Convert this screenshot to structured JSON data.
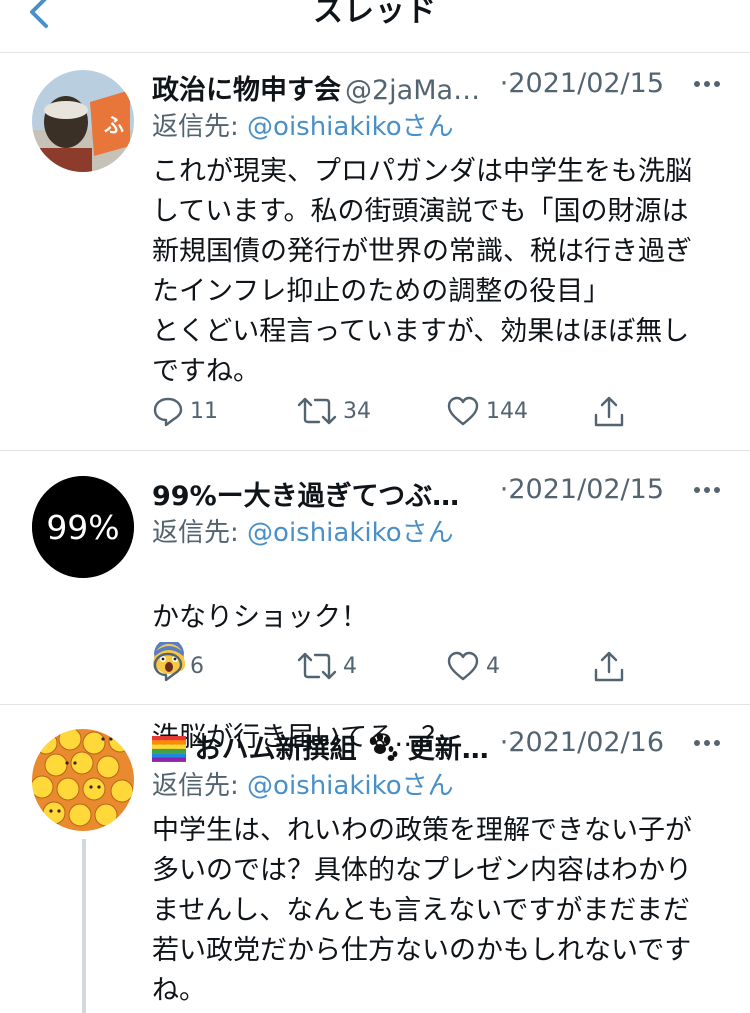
{
  "header": {
    "title": "スレッド"
  },
  "tweets": [
    {
      "name": "政治に物申す会",
      "handle": "@2jaMa…",
      "date": "·2021/02/15",
      "reply_prefix": "返信先: ",
      "reply_mention": "@oishiakiko",
      "reply_suffix": "さん",
      "body": "これが現実、プロパガンダは中学生をも洗脳\nしています。私の街頭演説でも「国の財源は\n新規国債の発行が世界の常識、税は行き過ぎ\nたインフレ抑止のための調整の役目」\nとくどい程言っていますが、効果はほぼ無し\nですね。",
      "replies": "11",
      "retweets": "34",
      "likes": "144"
    },
    {
      "name": "99%ー大き過ぎてつぶ…",
      "avatar_text": "99%",
      "date": "·2021/02/15",
      "reply_prefix": "返信先: ",
      "reply_mention": "@oishiakiko",
      "reply_suffix": "さん",
      "body_line1": "かなりショック！",
      "body_line2": "洗脳が行き届いてる…？",
      "replies": "6",
      "retweets": "4",
      "likes": "4"
    },
    {
      "name": "おハム新撰組",
      "name_suffix": "更新…",
      "date": "·2021/02/16",
      "reply_prefix": "返信先: ",
      "reply_mention": "@oishiakiko",
      "reply_suffix": "さん",
      "body": "中学生は、れいわの政策を理解できない子が\n多いのでは？具体的なプレゼン内容はわかり\nませんし、なんとも言えないですがまだまだ\n若い政党だから仕方ないのかもしれないです\nね。"
    }
  ],
  "colors": {
    "mention": "#4a90c8",
    "secondary": "#536471",
    "divider": "#dfe3e6"
  },
  "icons": [
    "back-chevron-icon",
    "more-icon",
    "reply-icon",
    "retweet-icon",
    "like-icon",
    "share-icon",
    "rainbow-flag-icon",
    "paw-icon",
    "scared-face-emoji-icon"
  ]
}
